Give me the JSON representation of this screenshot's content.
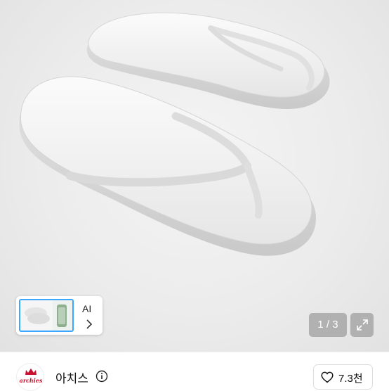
{
  "gallery": {
    "ai_label": "AI",
    "counter": "1 / 3"
  },
  "seller": {
    "avatar_text": "archies",
    "name": "아치스"
  },
  "like": {
    "count": "7.3천"
  },
  "icons": {
    "info": "info-icon",
    "heart": "heart-icon",
    "expand": "expand-icon",
    "chevron": "chevron-right-icon"
  },
  "colors": {
    "selection_border": "#3ba7ff",
    "brand_red": "#c8102e"
  }
}
